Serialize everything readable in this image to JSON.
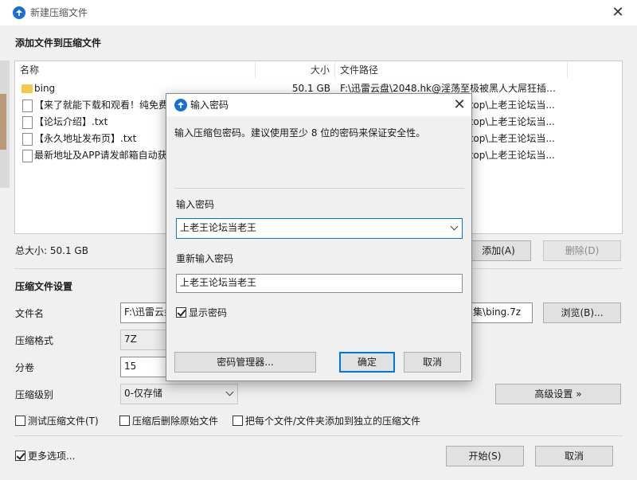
{
  "window": {
    "title": "新建压缩文件"
  },
  "add_files_section": {
    "heading": "添加文件到压缩文件"
  },
  "file_table": {
    "headers": {
      "name": "名称",
      "size": "大小",
      "path": "文件路径"
    },
    "rows": [
      {
        "name": "bing",
        "size": "50.1 GB",
        "path": "F:\\迅雷云盘\\2048.hk@淫荡至极被黑人大屌狂插猛...",
        "type": "folder"
      },
      {
        "name": "【来了就能下载和观看！纯免费",
        "size": "",
        "path": "ttop\\上老王论坛当...",
        "type": "file"
      },
      {
        "name": "【论坛介绍】.txt",
        "size": "",
        "path": "ttop\\上老王论坛当...",
        "type": "file"
      },
      {
        "name": "【永久地址发布页】.txt",
        "size": "",
        "path": "ttop\\上老王论坛当...",
        "type": "file"
      },
      {
        "name": "最新地址及APP请发邮箱自动获",
        "size": "",
        "path": "ttop\\上老王论坛当...",
        "type": "file"
      }
    ]
  },
  "total_size": "总大小: 50.1 GB",
  "buttons": {
    "add": "添加(A)",
    "delete": "删除(D)",
    "browse": "浏览(B)...",
    "advanced": "高级设置 »",
    "start": "开始(S)",
    "cancel": "取消"
  },
  "settings": {
    "heading": "压缩文件设置",
    "filename_label": "文件名",
    "filename_value": "F:\\迅雷云盘",
    "filename_tail": "集\\bing.7z",
    "format_label": "压缩格式",
    "format_value": "7Z",
    "split_label": "分卷",
    "split_value": "15",
    "level_label": "压缩级别",
    "level_value": "0-仅存储"
  },
  "options": {
    "test": "测试压缩文件(T)",
    "delete_source": "压缩后删除原始文件",
    "each_separate": "把每个文件/文件夹添加到独立的压缩文件",
    "more": "更多选项..."
  },
  "dialog": {
    "title": "输入密码",
    "description": "输入压缩包密码。建议使用至少 8 位的密码来保证安全性。",
    "password_label": "输入密码",
    "password_value": "上老王论坛当老王",
    "confirm_label": "重新输入密码",
    "confirm_value": "上老王论坛当老王",
    "show_password": "显示密码",
    "manager_button": "密码管理器...",
    "ok_button": "确定",
    "cancel_button": "取消"
  }
}
